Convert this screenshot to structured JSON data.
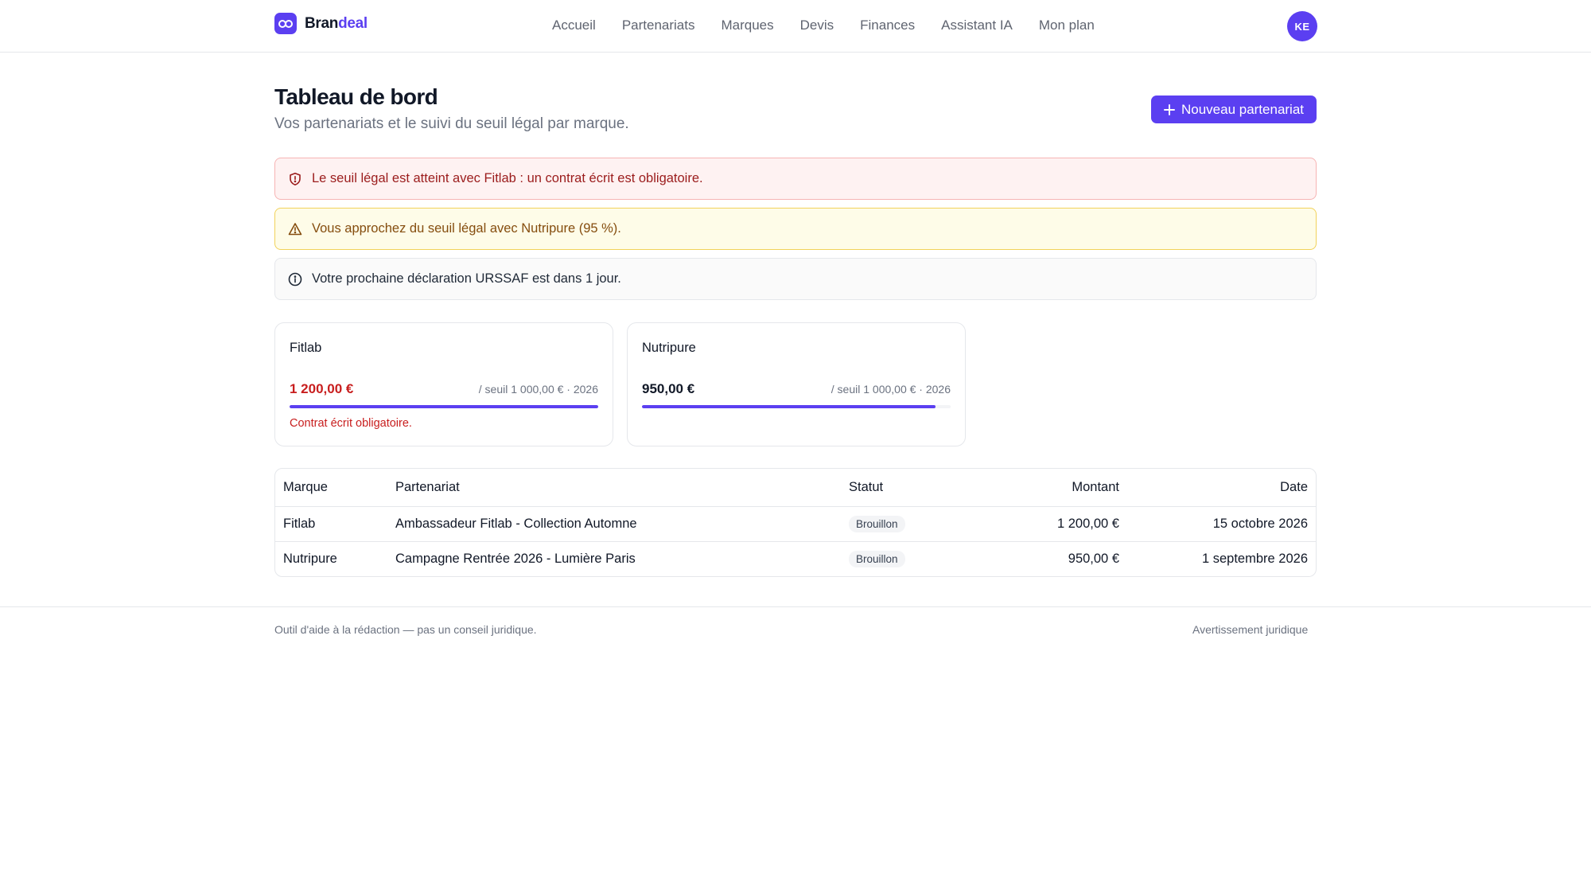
{
  "app": {
    "logo_text_a": "Bran",
    "logo_text_b": "deal",
    "logo_icon": "infinity-link-icon",
    "brand_color": "#5b3ff1"
  },
  "nav": {
    "items": [
      {
        "label": "Accueil"
      },
      {
        "label": "Partenariats"
      },
      {
        "label": "Marques"
      },
      {
        "label": "Devis"
      },
      {
        "label": "Finances"
      },
      {
        "label": "Assistant IA"
      },
      {
        "label": "Mon plan"
      }
    ]
  },
  "user": {
    "initials": "KE"
  },
  "page": {
    "title": "Tableau de bord",
    "subtitle": "Vos partenariats et le suivi du seuil légal par marque.",
    "new_button_label": "Nouveau partenariat",
    "new_button_icon": "plus-icon"
  },
  "alerts": [
    {
      "type": "danger",
      "icon": "shield-alert-icon",
      "text": "Le seuil légal est atteint avec Fitlab : un contrat écrit est obligatoire.",
      "color": "#9b1c1c"
    },
    {
      "type": "warning",
      "icon": "warning-triangle-icon",
      "text": "Vous approchez du seuil légal avec Nutripure (95 %).",
      "color": "#854d0e"
    },
    {
      "type": "info",
      "icon": "info-circle-icon",
      "text": "Votre prochaine déclaration URSSAF est dans 1 jour.",
      "color": "#1f2937"
    }
  ],
  "brand_cards": [
    {
      "name": "Fitlab",
      "amount": "1 200,00 €",
      "threshold": "/ seuil 1 000,00 € · 2026",
      "progress": 1.0,
      "note": "Contrat écrit obligatoire.",
      "amount_color": "#c81e1e"
    },
    {
      "name": "Nutripure",
      "amount": "950,00 €",
      "threshold": "/ seuil 1 000,00 € · 2026",
      "progress": 0.95,
      "note": "",
      "amount_color": "#111827"
    }
  ],
  "table": {
    "headers": {
      "brand": "Marque",
      "partnership": "Partenariat",
      "status": "Statut",
      "amount": "Montant",
      "date": "Date"
    },
    "rows": [
      {
        "brand": "Fitlab",
        "partnership": "Ambassadeur Fitlab - Collection Automne",
        "status": "Brouillon",
        "amount": "1 200,00 €",
        "date": "15 octobre 2026"
      },
      {
        "brand": "Nutripure",
        "partnership": "Campagne Rentrée 2026 - Lumière Paris",
        "status": "Brouillon",
        "amount": "950,00 €",
        "date": "1 septembre 2026"
      }
    ]
  },
  "footer": {
    "disclaimer": "Outil d'aide à la rédaction — pas un conseil juridique.",
    "legal_link": "Avertissement juridique"
  }
}
